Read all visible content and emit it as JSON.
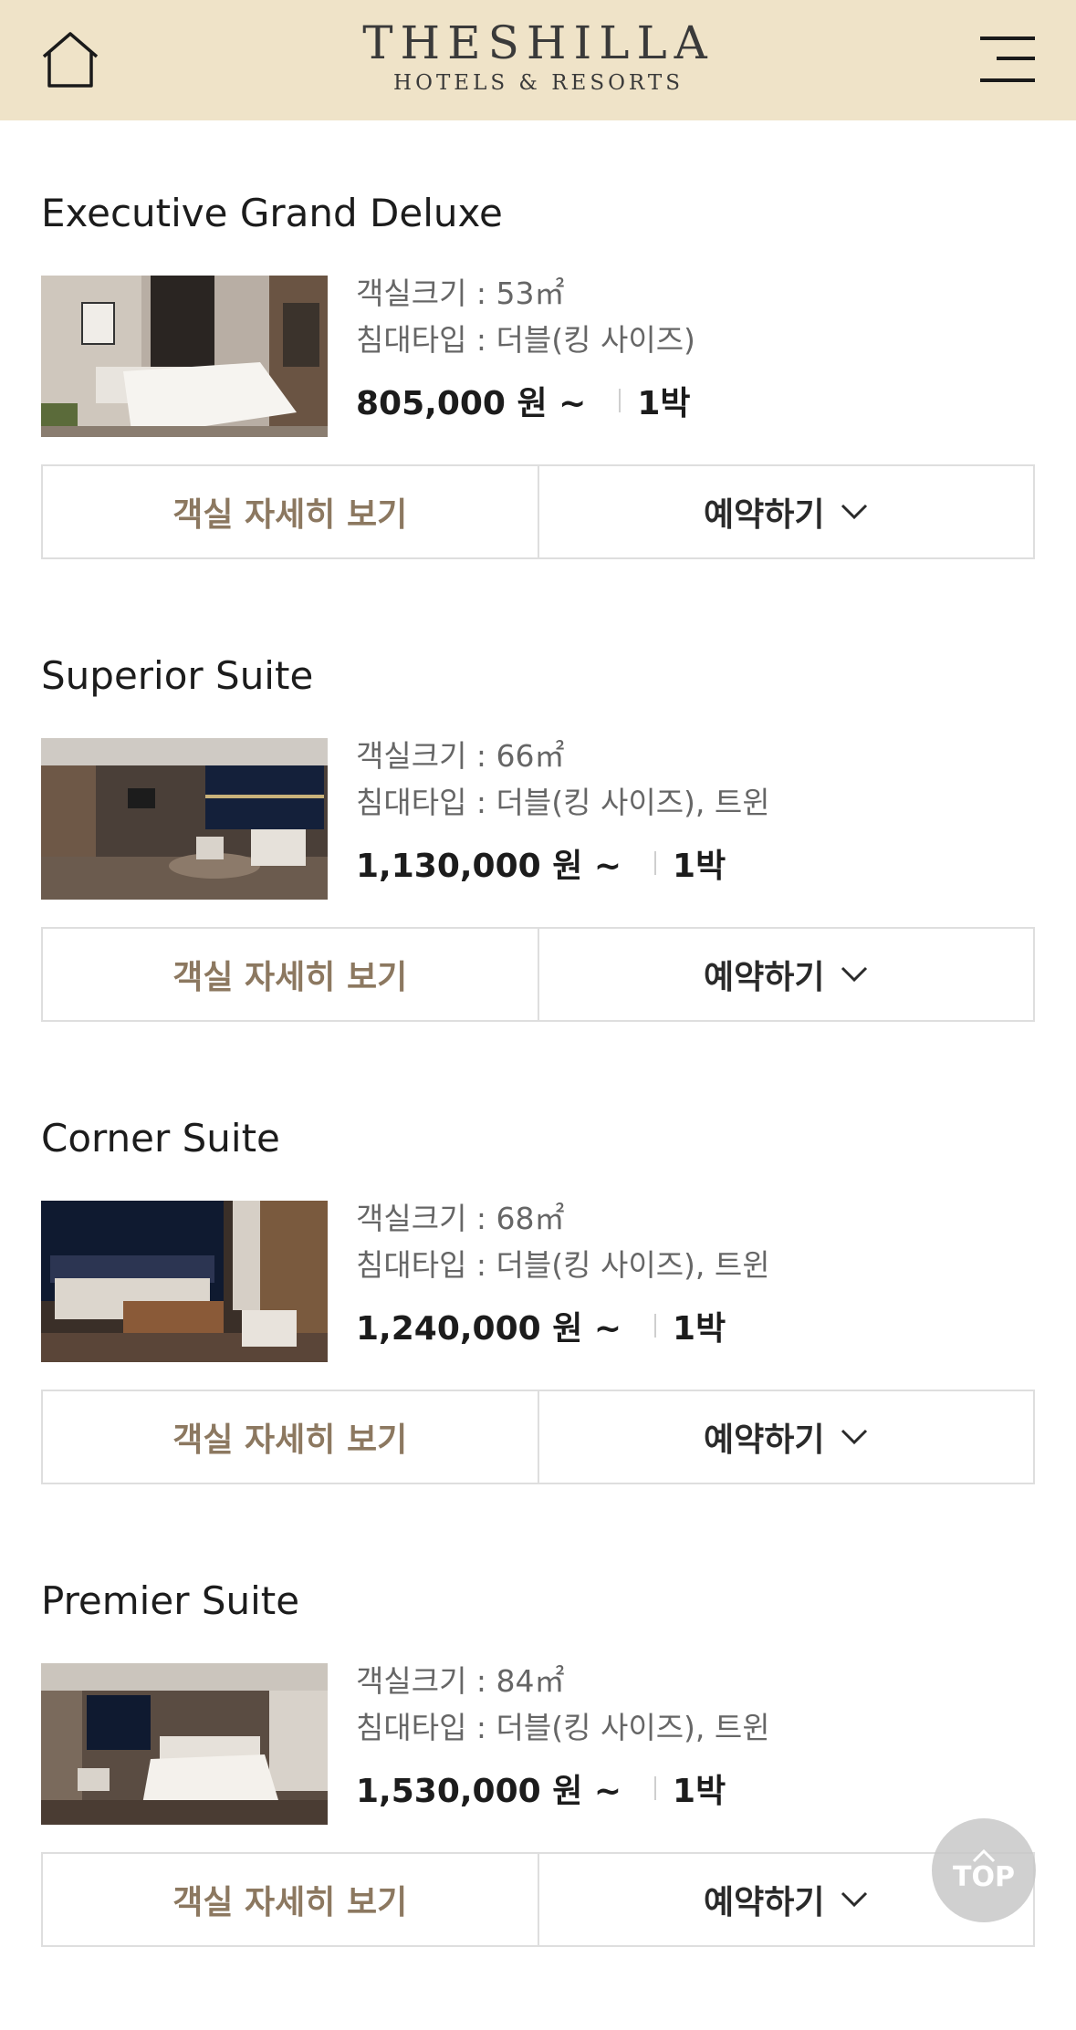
{
  "header": {
    "logo_main": "THESHILLA",
    "logo_sub": "HOTELS & RESORTS",
    "home_icon": "home-icon",
    "menu_icon": "hamburger-menu-icon",
    "background_color": "#efe3c8"
  },
  "rooms": [
    {
      "name": "Executive Grand Deluxe",
      "size": "객실크기 : 53㎡",
      "bed": "침대타입 : 더블(킹 사이즈)",
      "price": "805,000 원 ~",
      "nights": "1박",
      "detail_label": "객실 자세히 보기",
      "book_label": "예약하기"
    },
    {
      "name": "Superior Suite",
      "size": "객실크기 : 66㎡",
      "bed": "침대타입 : 더블(킹 사이즈), 트윈",
      "price": "1,130,000 원 ~",
      "nights": "1박",
      "detail_label": "객실 자세히 보기",
      "book_label": "예약하기"
    },
    {
      "name": "Corner Suite",
      "size": "객실크기 : 68㎡",
      "bed": "침대타입 : 더블(킹 사이즈), 트윈",
      "price": "1,240,000 원 ~",
      "nights": "1박",
      "detail_label": "객실 자세히 보기",
      "book_label": "예약하기"
    },
    {
      "name": "Premier Suite",
      "size": "객실크기 : 84㎡",
      "bed": "침대타입 : 더블(킹 사이즈), 트윈",
      "price": "1,530,000 원 ~",
      "nights": "1박",
      "detail_label": "객실 자세히 보기",
      "book_label": "예약하기"
    }
  ],
  "scroll_top": {
    "label": "TOP",
    "icon": "chevron-up-icon"
  },
  "colors": {
    "detail_text": "#8c7860",
    "header_bg": "#efe3c8",
    "border": "#dedede"
  }
}
